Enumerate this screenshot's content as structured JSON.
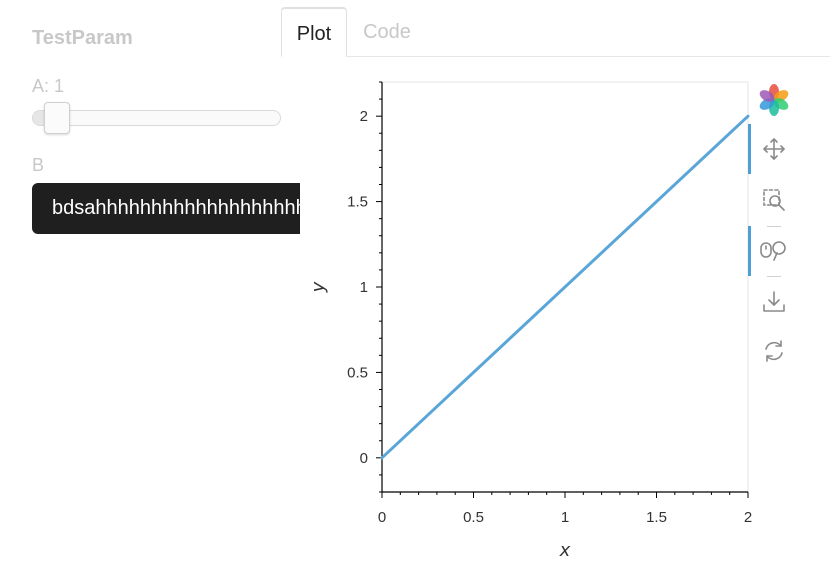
{
  "param_title": "TestParam",
  "slider": {
    "label": "A: 1",
    "value_fraction": 0.1
  },
  "field": {
    "label": "B",
    "value": "bdsahhhhhhhhhhhhhhhhhhhhhh"
  },
  "tabs": [
    {
      "label": "Plot",
      "active": true
    },
    {
      "label": "Code",
      "active": false
    }
  ],
  "toolbar": {
    "logo": "bokeh-logo-icon",
    "tools": [
      {
        "name": "pan",
        "icon": "pan-move-icon",
        "active": true
      },
      {
        "name": "box-zoom",
        "icon": "box-zoom-icon",
        "active": false
      },
      {
        "name": "wheel-zoom",
        "icon": "wheel-zoom-icon",
        "active": true
      },
      {
        "name": "save",
        "icon": "download-icon",
        "active": false
      },
      {
        "name": "reset",
        "icon": "reset-icon",
        "active": false
      }
    ],
    "accent": "#4e9fd5"
  },
  "chart_data": {
    "type": "line",
    "x": [
      0,
      2
    ],
    "series": [
      {
        "values": [
          0,
          2
        ],
        "color": "#5aa6d8"
      }
    ],
    "xlabel": "x",
    "ylabel": "y",
    "xlim": [
      0,
      2
    ],
    "ylim": [
      -0.2,
      2.2
    ],
    "xticks": [
      "0",
      "0.5",
      "1",
      "1.5",
      "2"
    ],
    "yticks": [
      "0",
      "0.5",
      "1",
      "1.5",
      "2"
    ],
    "grid": false
  }
}
